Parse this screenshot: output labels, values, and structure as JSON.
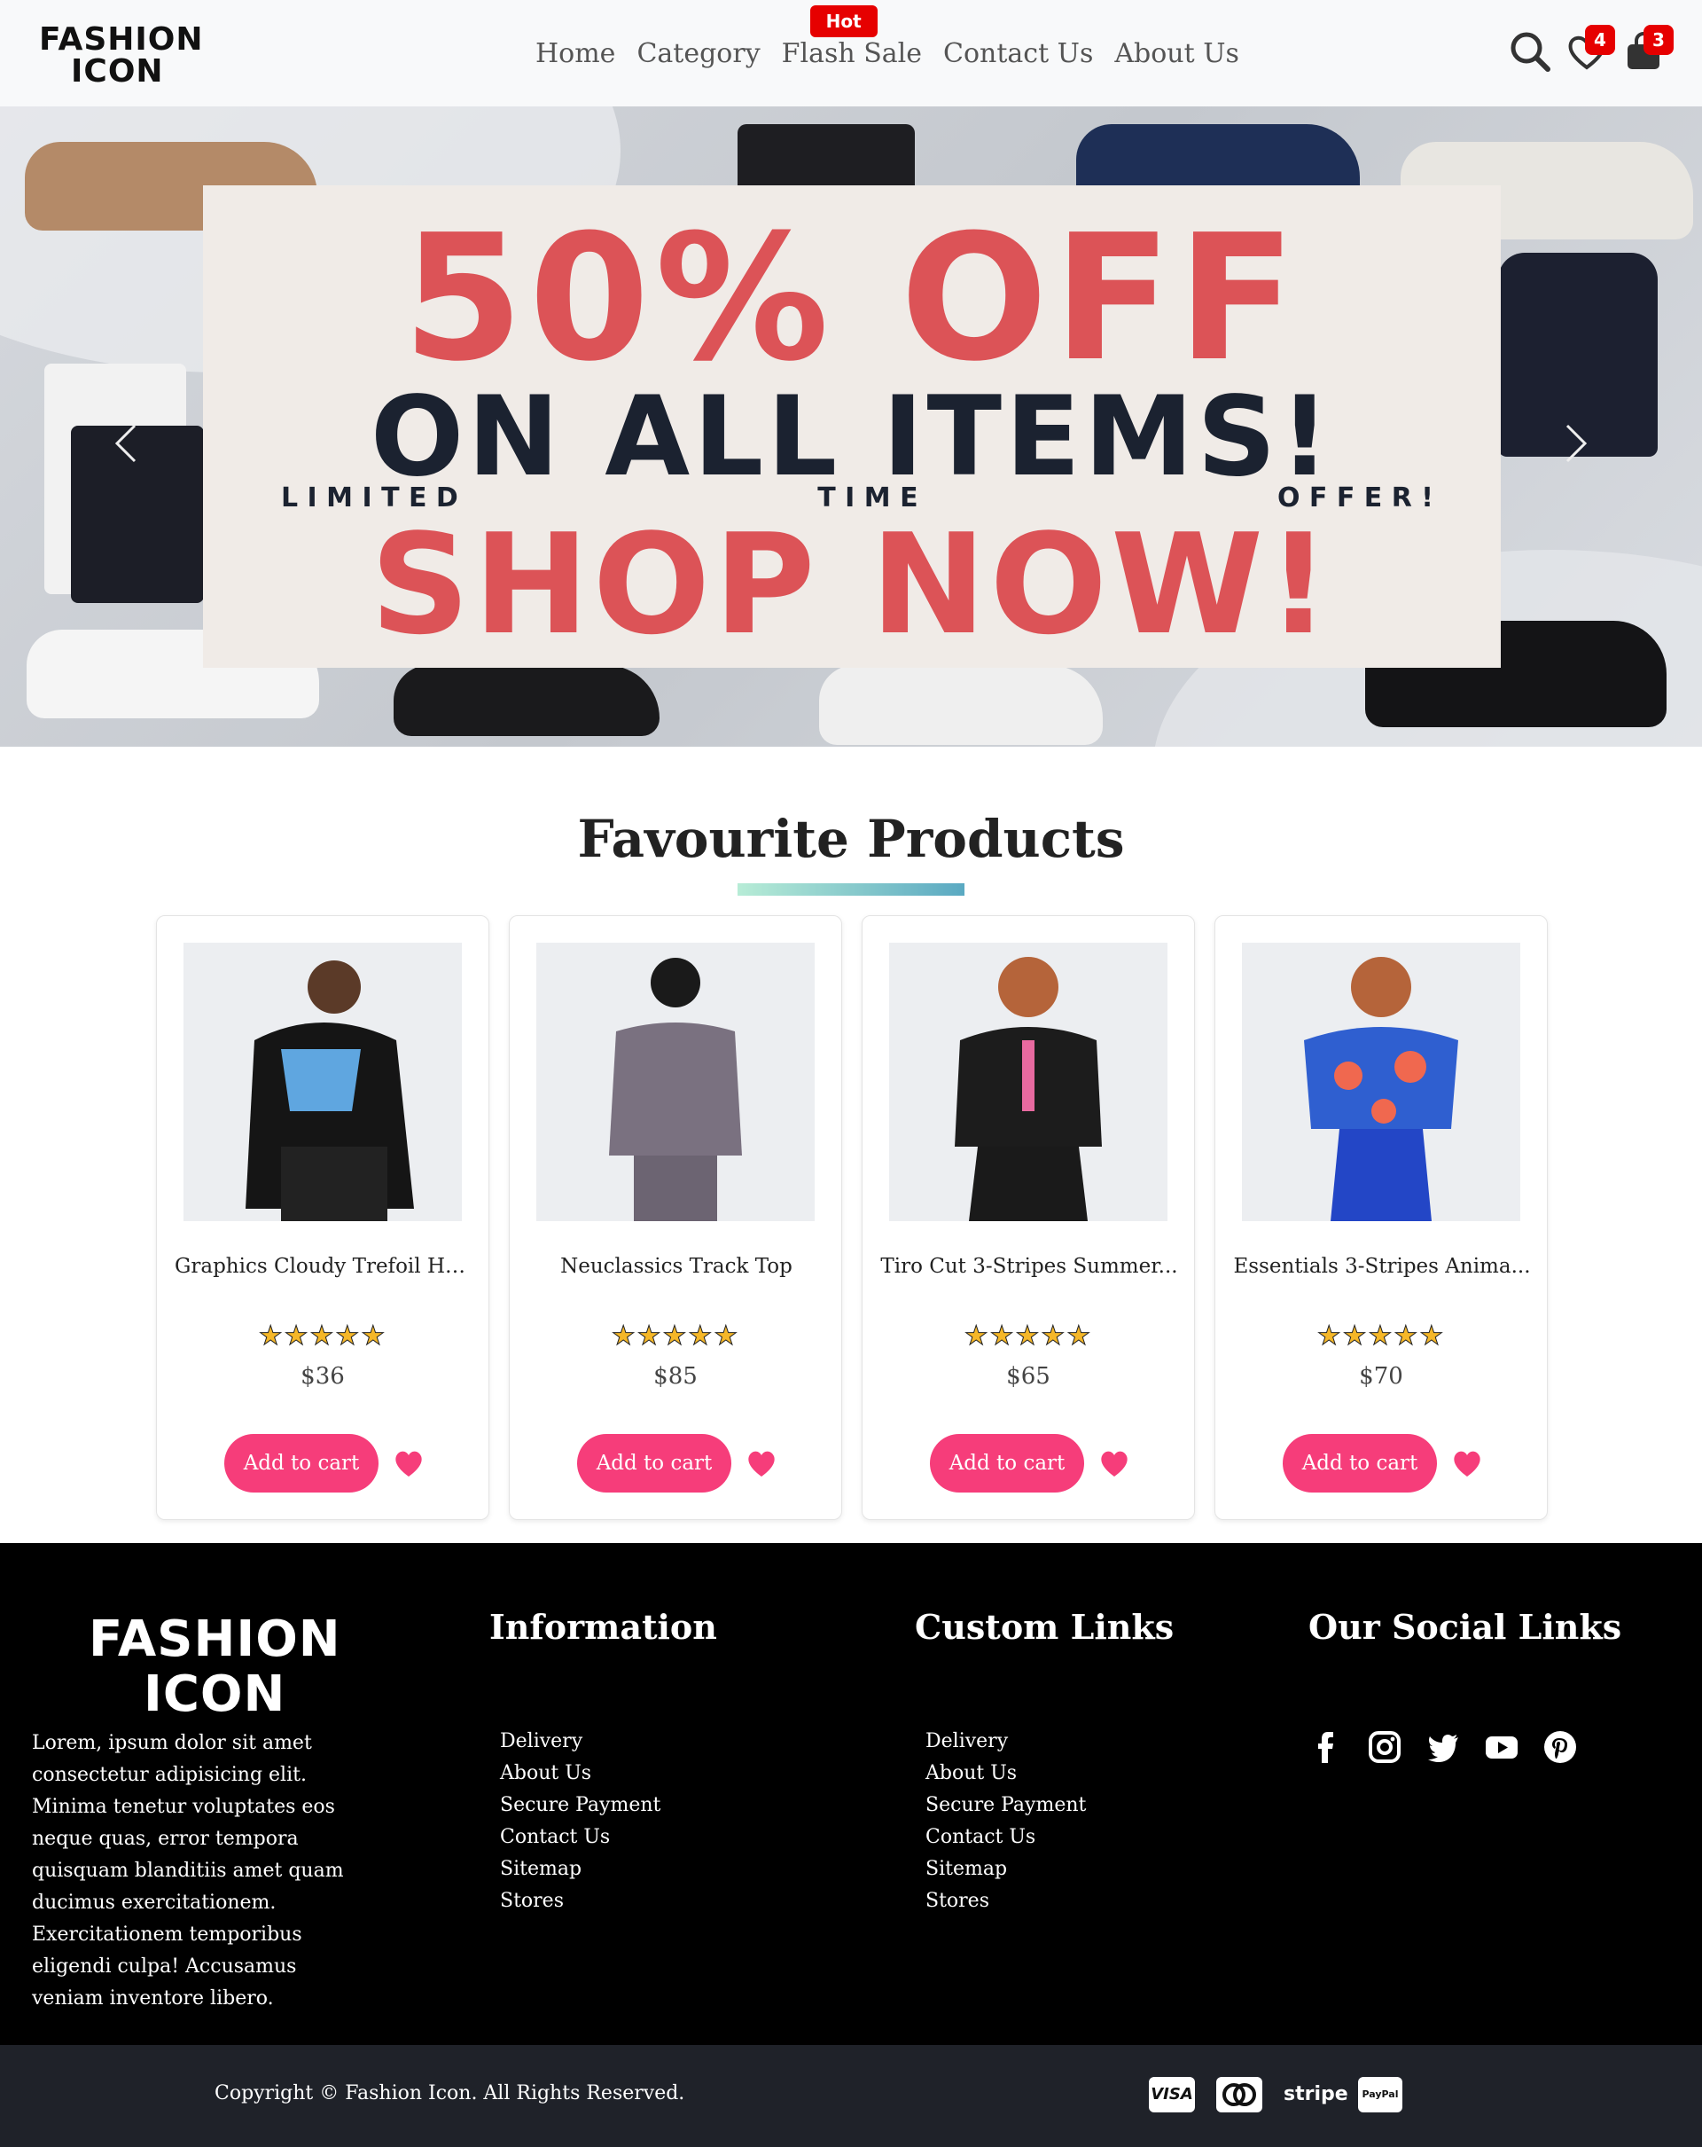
{
  "brand": {
    "logo_line1": "FASHION",
    "logo_line2": "ICON"
  },
  "nav": {
    "items": [
      {
        "label": "Home"
      },
      {
        "label": "Category"
      },
      {
        "label": "Flash Sale",
        "badge": "Hot"
      },
      {
        "label": "Contact Us"
      },
      {
        "label": "About Us"
      }
    ],
    "wishlist_count": "4",
    "cart_count": "3",
    "icons": [
      "search-icon",
      "heart-icon",
      "bag-icon"
    ]
  },
  "hero": {
    "line1": "50% OFF",
    "line2": "ON ALL ITEMS!",
    "line3_words": [
      "L I M I T E D",
      "T I M E",
      "O F F E R !"
    ],
    "line4": "SHOP NOW!",
    "accent_color": "#dc5357",
    "dark_color": "#1b2230"
  },
  "favourites": {
    "title": "Favourite Products",
    "products": [
      {
        "name": "Graphics Cloudy Trefoil Ho...",
        "stars": "★★★★★",
        "price": "$36",
        "cart_label": "Add to cart"
      },
      {
        "name": "Neuclassics Track Top",
        "stars": "★★★★★",
        "price": "$85",
        "cart_label": "Add to cart"
      },
      {
        "name": "Tiro Cut 3-Stripes Summer...",
        "stars": "★★★★★",
        "price": "$65",
        "cart_label": "Add to cart"
      },
      {
        "name": "Essentials 3-Stripes Anima...",
        "stars": "★★★★★",
        "price": "$70",
        "cart_label": "Add to cart"
      }
    ],
    "button_color": "#f63d7a"
  },
  "footer": {
    "logo_line1": "FASHION",
    "logo_line2": "ICON",
    "description": "Lorem, ipsum dolor sit amet consectetur adipisicing elit. Minima tenetur voluptates eos neque quas, error tempora quisquam blanditiis amet quam ducimus exercitationem. Exercitationem temporibus eligendi culpa! Accusamus veniam inventore libero.",
    "information": {
      "title": "Information",
      "links": [
        "Delivery",
        "About Us",
        "Secure Payment",
        "Contact Us",
        "Sitemap",
        "Stores"
      ]
    },
    "custom": {
      "title": "Custom Links",
      "links": [
        "Delivery",
        "About Us",
        "Secure Payment",
        "Contact Us",
        "Sitemap",
        "Stores"
      ]
    },
    "social": {
      "title": "Our Social Links",
      "icons": [
        "facebook-icon",
        "instagram-icon",
        "twitter-icon",
        "youtube-icon",
        "pinterest-icon"
      ]
    },
    "copyright": "Copyright © Fashion Icon. All Rights Reserved.",
    "payments": [
      "VISA",
      "stripe",
      "PayPal"
    ]
  }
}
